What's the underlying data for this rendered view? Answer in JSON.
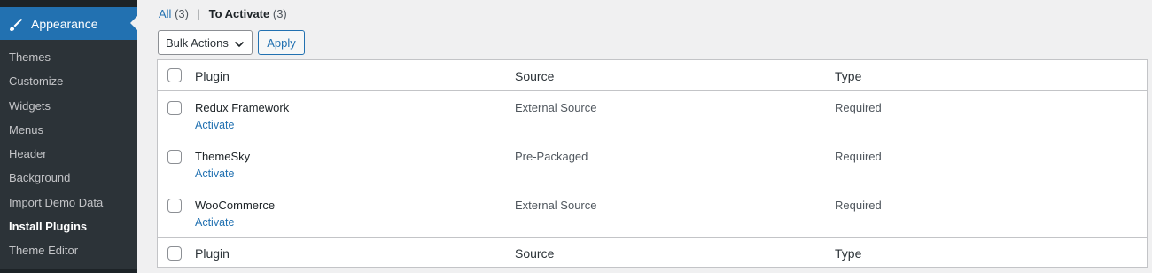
{
  "sidebar": {
    "current_menu": "Appearance",
    "current_menu_icon": "paintbrush-icon",
    "items": [
      {
        "label": "Themes"
      },
      {
        "label": "Customize"
      },
      {
        "label": "Widgets"
      },
      {
        "label": "Menus"
      },
      {
        "label": "Header"
      },
      {
        "label": "Background"
      },
      {
        "label": "Import Demo Data"
      },
      {
        "label": "Install Plugins",
        "current": true
      },
      {
        "label": "Theme Editor"
      }
    ]
  },
  "filters": {
    "all_label": "All",
    "all_count": "(3)",
    "separator": "|",
    "activate_label": "To Activate",
    "activate_count": "(3)"
  },
  "bulk": {
    "selected": "Bulk Actions",
    "apply_label": "Apply"
  },
  "table": {
    "columns": [
      "Plugin",
      "Source",
      "Type"
    ],
    "rows": [
      {
        "plugin": "Redux Framework",
        "action": "Activate",
        "source": "External Source",
        "type": "Required"
      },
      {
        "plugin": "ThemeSky",
        "action": "Activate",
        "source": "Pre-Packaged",
        "type": "Required"
      },
      {
        "plugin": "WooCommerce",
        "action": "Activate",
        "source": "External Source",
        "type": "Required"
      }
    ]
  },
  "colors": {
    "sidebar_bg": "#2c3338",
    "accent": "#2271b1",
    "page_bg": "#f0f0f1"
  }
}
